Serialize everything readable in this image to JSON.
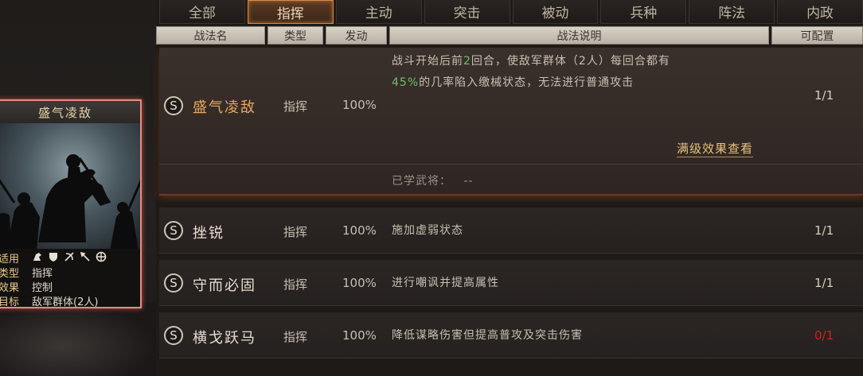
{
  "tabs": [
    {
      "label": "全部",
      "active": false
    },
    {
      "label": "指挥",
      "active": true
    },
    {
      "label": "主动",
      "active": false
    },
    {
      "label": "突击",
      "active": false
    },
    {
      "label": "被动",
      "active": false
    },
    {
      "label": "兵种",
      "active": false
    },
    {
      "label": "阵法",
      "active": false
    },
    {
      "label": "内政",
      "active": false
    }
  ],
  "columns": {
    "name": "战法名",
    "type": "类型",
    "rate": "发动",
    "desc": "战法说明",
    "config": "可配置"
  },
  "skills": [
    {
      "badge": "S",
      "name": "盛气凌敌",
      "type": "指挥",
      "rate": "100%",
      "desc_line1_a": "战斗开始后前",
      "desc_line1_num": "2",
      "desc_line1_b": "回合，使敌军群体（2人）每回合都有",
      "desc_line2_pct": "45%",
      "desc_line2_b": "的几率陷入缴械状态，无法进行普通攻击",
      "config": "1/1",
      "full_effect_link": "满级效果查看",
      "learned_label": "已学武将：",
      "learned_value": "--"
    },
    {
      "badge": "S",
      "name": "挫锐",
      "type": "指挥",
      "rate": "100%",
      "desc": "施加虚弱状态",
      "config": "1/1"
    },
    {
      "badge": "S",
      "name": "守而必固",
      "type": "指挥",
      "rate": "100%",
      "desc": "进行嘲讽并提高属性",
      "config": "1/1"
    },
    {
      "badge": "S",
      "name": "横戈跃马",
      "type": "指挥",
      "rate": "100%",
      "desc": "降低谋略伤害但提高普攻及突击伤害",
      "config": "0/1"
    }
  ],
  "card": {
    "title": "盛气凌敌",
    "troops_label": "适用",
    "type_label": "类型",
    "type_value": "指挥",
    "effect_label": "效果",
    "effect_value": "控制",
    "target_label": "目标",
    "target_value": "敌军群体(2人)",
    "troop_icons": [
      "cavalry-icon",
      "shield-icon",
      "bow-icon",
      "spear-icon",
      "chariot-icon"
    ]
  },
  "colors": {
    "tab_active_border": "#d48a4a",
    "highlight_name": "#e9a65e",
    "number_green": "#6fbf6a",
    "config_warn": "#d8201a",
    "card_border": "#e88a82"
  }
}
